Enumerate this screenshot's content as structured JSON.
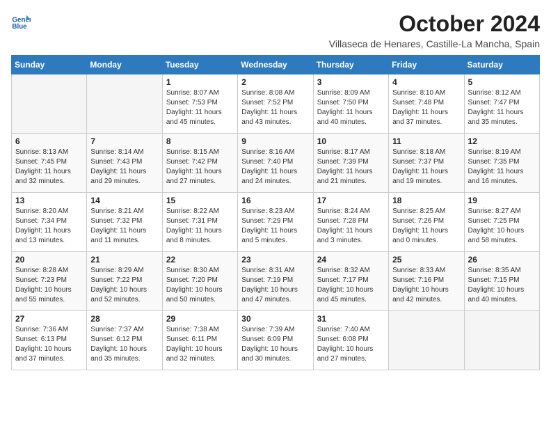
{
  "logo": {
    "line1": "General",
    "line2": "Blue"
  },
  "title": "October 2024",
  "location": "Villaseca de Henares, Castille-La Mancha, Spain",
  "days_of_week": [
    "Sunday",
    "Monday",
    "Tuesday",
    "Wednesday",
    "Thursday",
    "Friday",
    "Saturday"
  ],
  "weeks": [
    [
      {
        "day": "",
        "info": ""
      },
      {
        "day": "",
        "info": ""
      },
      {
        "day": "1",
        "info": "Sunrise: 8:07 AM\nSunset: 7:53 PM\nDaylight: 11 hours and 45 minutes."
      },
      {
        "day": "2",
        "info": "Sunrise: 8:08 AM\nSunset: 7:52 PM\nDaylight: 11 hours and 43 minutes."
      },
      {
        "day": "3",
        "info": "Sunrise: 8:09 AM\nSunset: 7:50 PM\nDaylight: 11 hours and 40 minutes."
      },
      {
        "day": "4",
        "info": "Sunrise: 8:10 AM\nSunset: 7:48 PM\nDaylight: 11 hours and 37 minutes."
      },
      {
        "day": "5",
        "info": "Sunrise: 8:12 AM\nSunset: 7:47 PM\nDaylight: 11 hours and 35 minutes."
      }
    ],
    [
      {
        "day": "6",
        "info": "Sunrise: 8:13 AM\nSunset: 7:45 PM\nDaylight: 11 hours and 32 minutes."
      },
      {
        "day": "7",
        "info": "Sunrise: 8:14 AM\nSunset: 7:43 PM\nDaylight: 11 hours and 29 minutes."
      },
      {
        "day": "8",
        "info": "Sunrise: 8:15 AM\nSunset: 7:42 PM\nDaylight: 11 hours and 27 minutes."
      },
      {
        "day": "9",
        "info": "Sunrise: 8:16 AM\nSunset: 7:40 PM\nDaylight: 11 hours and 24 minutes."
      },
      {
        "day": "10",
        "info": "Sunrise: 8:17 AM\nSunset: 7:39 PM\nDaylight: 11 hours and 21 minutes."
      },
      {
        "day": "11",
        "info": "Sunrise: 8:18 AM\nSunset: 7:37 PM\nDaylight: 11 hours and 19 minutes."
      },
      {
        "day": "12",
        "info": "Sunrise: 8:19 AM\nSunset: 7:35 PM\nDaylight: 11 hours and 16 minutes."
      }
    ],
    [
      {
        "day": "13",
        "info": "Sunrise: 8:20 AM\nSunset: 7:34 PM\nDaylight: 11 hours and 13 minutes."
      },
      {
        "day": "14",
        "info": "Sunrise: 8:21 AM\nSunset: 7:32 PM\nDaylight: 11 hours and 11 minutes."
      },
      {
        "day": "15",
        "info": "Sunrise: 8:22 AM\nSunset: 7:31 PM\nDaylight: 11 hours and 8 minutes."
      },
      {
        "day": "16",
        "info": "Sunrise: 8:23 AM\nSunset: 7:29 PM\nDaylight: 11 hours and 5 minutes."
      },
      {
        "day": "17",
        "info": "Sunrise: 8:24 AM\nSunset: 7:28 PM\nDaylight: 11 hours and 3 minutes."
      },
      {
        "day": "18",
        "info": "Sunrise: 8:25 AM\nSunset: 7:26 PM\nDaylight: 11 hours and 0 minutes."
      },
      {
        "day": "19",
        "info": "Sunrise: 8:27 AM\nSunset: 7:25 PM\nDaylight: 10 hours and 58 minutes."
      }
    ],
    [
      {
        "day": "20",
        "info": "Sunrise: 8:28 AM\nSunset: 7:23 PM\nDaylight: 10 hours and 55 minutes."
      },
      {
        "day": "21",
        "info": "Sunrise: 8:29 AM\nSunset: 7:22 PM\nDaylight: 10 hours and 52 minutes."
      },
      {
        "day": "22",
        "info": "Sunrise: 8:30 AM\nSunset: 7:20 PM\nDaylight: 10 hours and 50 minutes."
      },
      {
        "day": "23",
        "info": "Sunrise: 8:31 AM\nSunset: 7:19 PM\nDaylight: 10 hours and 47 minutes."
      },
      {
        "day": "24",
        "info": "Sunrise: 8:32 AM\nSunset: 7:17 PM\nDaylight: 10 hours and 45 minutes."
      },
      {
        "day": "25",
        "info": "Sunrise: 8:33 AM\nSunset: 7:16 PM\nDaylight: 10 hours and 42 minutes."
      },
      {
        "day": "26",
        "info": "Sunrise: 8:35 AM\nSunset: 7:15 PM\nDaylight: 10 hours and 40 minutes."
      }
    ],
    [
      {
        "day": "27",
        "info": "Sunrise: 7:36 AM\nSunset: 6:13 PM\nDaylight: 10 hours and 37 minutes."
      },
      {
        "day": "28",
        "info": "Sunrise: 7:37 AM\nSunset: 6:12 PM\nDaylight: 10 hours and 35 minutes."
      },
      {
        "day": "29",
        "info": "Sunrise: 7:38 AM\nSunset: 6:11 PM\nDaylight: 10 hours and 32 minutes."
      },
      {
        "day": "30",
        "info": "Sunrise: 7:39 AM\nSunset: 6:09 PM\nDaylight: 10 hours and 30 minutes."
      },
      {
        "day": "31",
        "info": "Sunrise: 7:40 AM\nSunset: 6:08 PM\nDaylight: 10 hours and 27 minutes."
      },
      {
        "day": "",
        "info": ""
      },
      {
        "day": "",
        "info": ""
      }
    ]
  ]
}
